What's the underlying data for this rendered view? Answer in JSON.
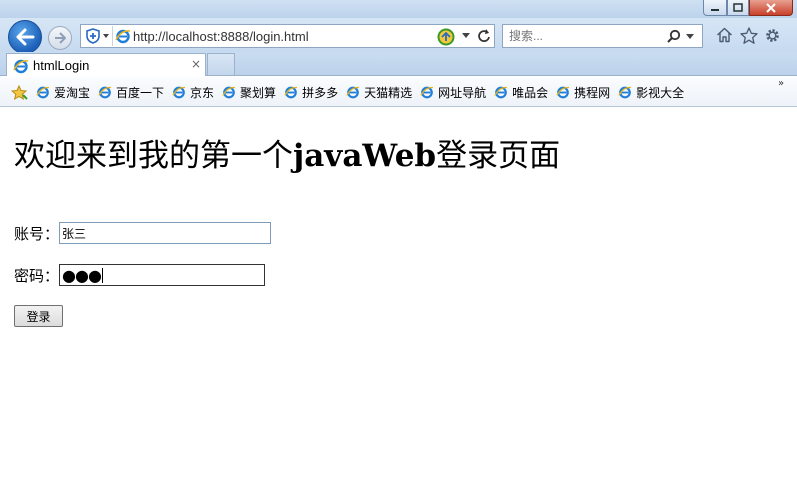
{
  "browser": {
    "address": "http://localhost:8888/login.html",
    "search_placeholder": "搜索...",
    "tab_title": "htmlLogin",
    "tab_close": "×",
    "favorites": [
      {
        "label": "爱淘宝"
      },
      {
        "label": "百度一下"
      },
      {
        "label": "京东"
      },
      {
        "label": "聚划算"
      },
      {
        "label": "拼多多"
      },
      {
        "label": "天猫精选"
      },
      {
        "label": "网址导航"
      },
      {
        "label": "唯品会"
      },
      {
        "label": "携程网"
      },
      {
        "label": "影视大全"
      }
    ],
    "favbar_more": "»",
    "icons": [
      "back-icon",
      "forward-icon",
      "shield-icon",
      "ie-icon",
      "compat-icon",
      "refresh-icon",
      "search-icon",
      "home-icon",
      "star-icon",
      "gear-icon"
    ],
    "accent": "#1c5fb8"
  },
  "page": {
    "heading_prefix": "欢迎来到我的第一个",
    "heading_bold": "javaWeb",
    "heading_suffix": "登录页面",
    "account_label": "账号：",
    "account_value": "张三",
    "password_label": "密码：",
    "password_masked": "●●●",
    "login_button": "登录"
  }
}
